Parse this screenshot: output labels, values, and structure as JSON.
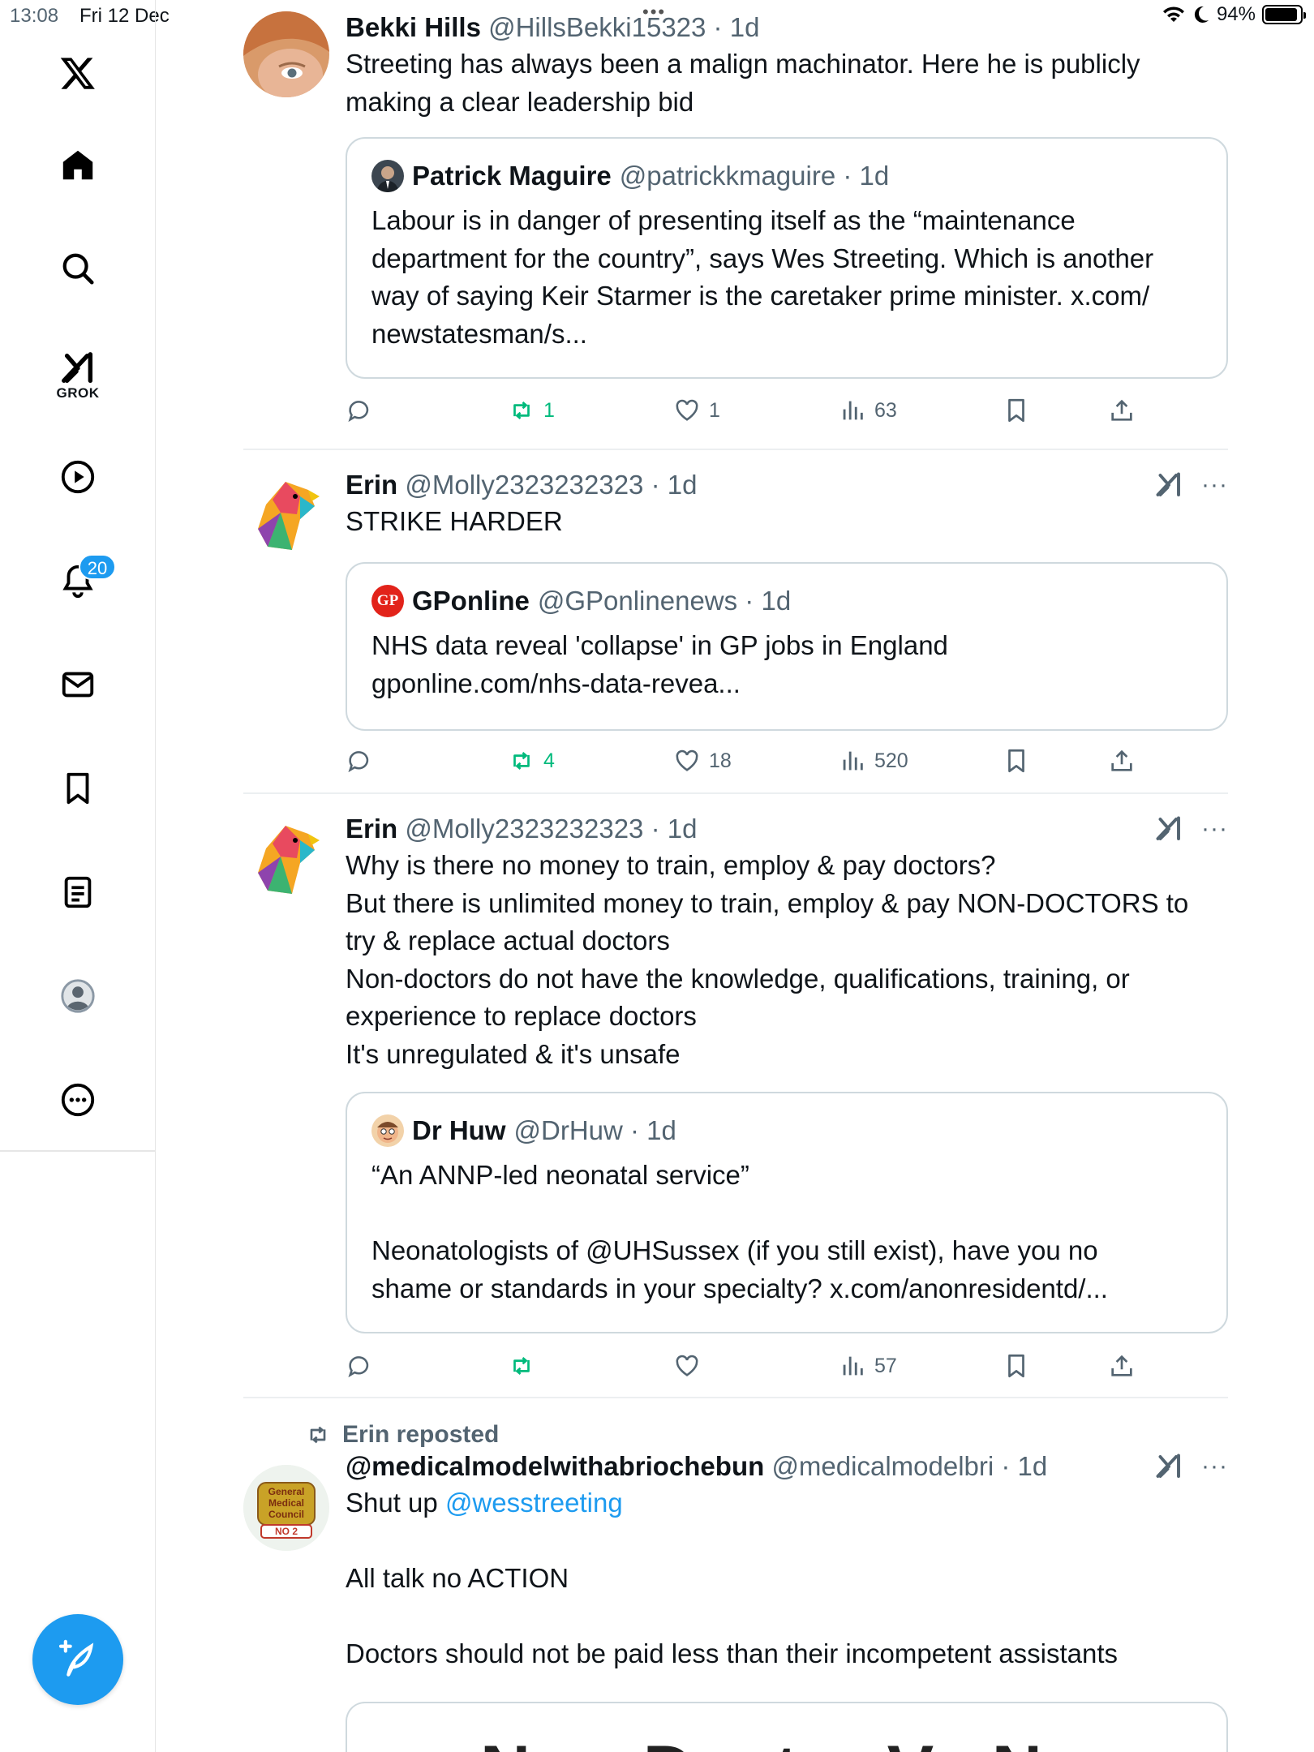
{
  "status": {
    "time": "13:08",
    "date": "Fri 12 Dec",
    "battery": "94%",
    "battery_level": 0.94
  },
  "sidebar": {
    "grok_label": "GROK",
    "notifications_badge": "20",
    "items": [
      "x-logo-icon",
      "home-icon",
      "search-icon",
      "grok-icon",
      "video-icon",
      "notifications-icon",
      "messages-icon",
      "bookmarks-icon",
      "lists-icon",
      "profile-icon",
      "more-icon"
    ],
    "compose_icon": "compose-feather-icon"
  },
  "tweets": [
    {
      "name": "Bekki Hills",
      "handle": "@HillsBekki15323",
      "time": "1d",
      "text": "Streeting has always been a malign machinator. Here he is publicly\nmaking a clear leadership bid",
      "quote": {
        "name": "Patrick Maguire",
        "handle": "@patrickkmaguire",
        "time": "1d",
        "text": "Labour is in danger of presenting itself as the “maintenance\ndepartment for the country”, says Wes Streeting. Which is another\nway of saying Keir Starmer is the caretaker prime minister. x.com/\nnewstatesman/s..."
      },
      "stats": {
        "replies": "",
        "reposts": "1",
        "likes": "1",
        "views": "63"
      }
    },
    {
      "name": "Erin",
      "handle": "@Molly2323232323",
      "time": "1d",
      "text": "STRIKE HARDER",
      "quote": {
        "name": "GPonline",
        "handle": "@GPonlinenews",
        "time": "1d",
        "avatar_text": "GP",
        "text": "NHS data reveal 'collapse' in GP jobs in England\ngponline.com/nhs-data-revea..."
      },
      "stats": {
        "replies": "",
        "reposts": "4",
        "likes": "18",
        "views": "520"
      }
    },
    {
      "name": "Erin",
      "handle": "@Molly2323232323",
      "time": "1d",
      "text": "Why is there no money to train, employ & pay doctors?\nBut there is unlimited money to train, employ & pay NON-DOCTORS to\ntry & replace actual doctors\nNon-doctors do not have the knowledge, qualifications, training, or\nexperience to replace doctors\nIt's unregulated & it's unsafe",
      "quote": {
        "name": "Dr Huw",
        "handle": "@DrHuw",
        "time": "1d",
        "text": "“An ANNP-led neonatal service”\n\nNeonatologists of @UHSussex (if you still exist), have you no\nshame or standards in your specialty? x.com/anonresidentd/..."
      },
      "stats": {
        "replies": "",
        "reposts": "",
        "likes": "",
        "views": "57"
      }
    },
    {
      "repost_label": "Erin reposted",
      "name": "@medicalmodelwithabriochebun",
      "handle": "@medicalmodelbri",
      "time": "1d",
      "avatar_text": "General Medical Council",
      "avatar_badge": "NO 2",
      "text_prefix": "Shut up ",
      "mention": "@wesstreeting",
      "text_rest": "\n\nAll talk no ACTION\n\nDoctors should not be paid less than their incompetent assistants",
      "card_text": "New Doctor Vs New"
    }
  ]
}
